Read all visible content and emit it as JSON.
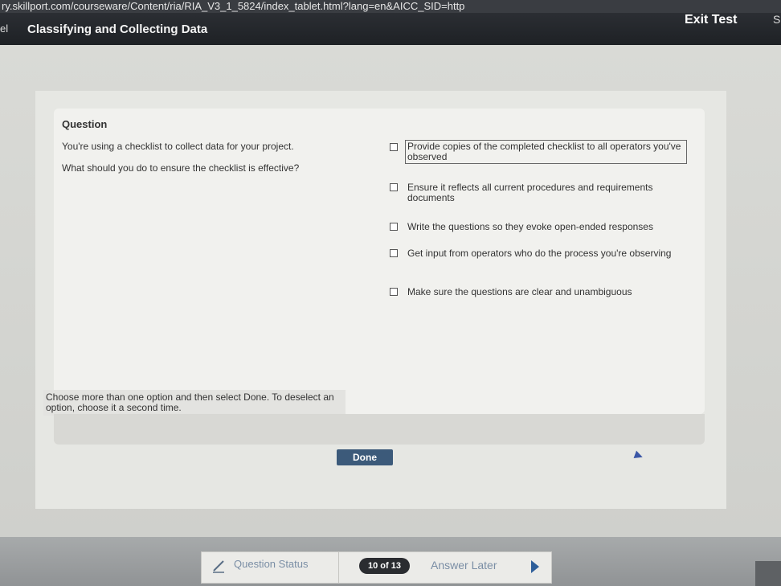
{
  "browser": {
    "url": "ry.skillport.com/courseware/Content/ria/RIA_V3_1_5824/index_tablet.html?lang=en&AICC_SID=http"
  },
  "header": {
    "back_label": "el",
    "course_title": "Classifying and Collecting Data",
    "exit_label": "Exit Test",
    "edge_char": "S"
  },
  "question": {
    "heading": "Question",
    "stem_line1": "You're using a checklist to collect data for your project.",
    "stem_line2": "What should you do to ensure the checklist is effective?",
    "options": [
      {
        "label": "Provide copies of the completed checklist to all operators you've observed",
        "selected": true
      },
      {
        "label": "Ensure it reflects all current procedures and requirements documents",
        "selected": false
      },
      {
        "label": "Write the questions so they evoke open-ended responses",
        "selected": false
      },
      {
        "label": "Get input from operators who do the process you're observing",
        "selected": false
      },
      {
        "label": "Make sure the questions are clear and unambiguous",
        "selected": false
      }
    ],
    "instructions": "Choose more than one option and then select Done. To deselect an option, choose it a second time.",
    "done_label": "Done"
  },
  "status_bar": {
    "question_status_label": "Question Status",
    "count": "10 of 13",
    "answer_later_label": "Answer Later"
  },
  "colors": {
    "header_bg": "#1e2125",
    "done_button": "#3c5a7a",
    "link_text": "#7a8ea5",
    "arrow": "#2e5f9a"
  }
}
